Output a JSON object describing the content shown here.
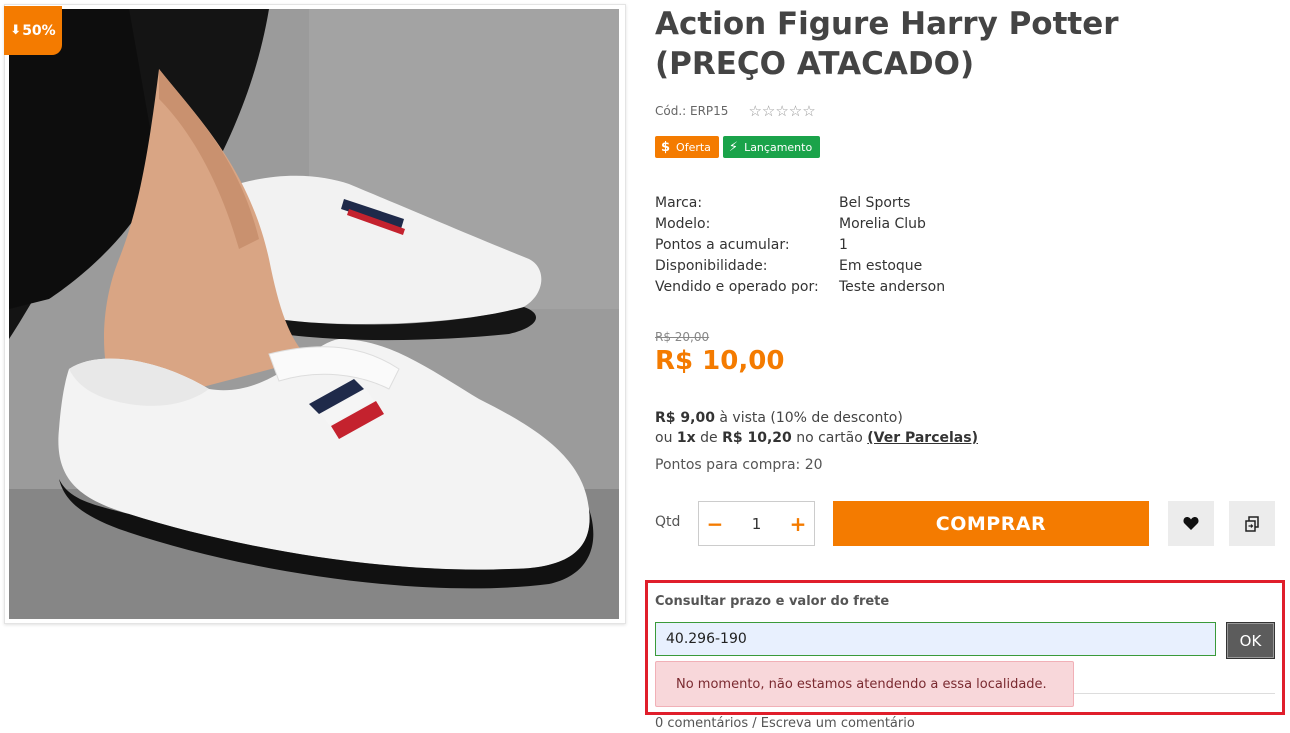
{
  "product": {
    "discount_badge": "50%",
    "title": "Action Figure Harry Potter (PREÇO ATACADO)",
    "sku": "Cód.: ERP15",
    "rating_stars": "☆☆☆☆☆",
    "tags": [
      {
        "icon": "$",
        "label": "Oferta"
      },
      {
        "icon": "⚡",
        "label": "Lançamento"
      }
    ],
    "specs": [
      {
        "label": "Marca:",
        "value": "Bel Sports"
      },
      {
        "label": "Modelo:",
        "value": "Morelia Club"
      },
      {
        "label": "Pontos a acumular:",
        "value": "1"
      },
      {
        "label": "Disponibilidade:",
        "value": "Em estoque"
      },
      {
        "label": "Vendido e operado por:",
        "value": "Teste anderson"
      }
    ],
    "old_price": "R$ 20,00",
    "price": "R$ 10,00",
    "cash_price": "R$ 9,00",
    "cash_text": " à vista (10% de desconto)",
    "installments_prefix": "ou ",
    "installments_count": "1x",
    "installments_de": " de ",
    "installments_value": "R$ 10,20",
    "installments_suffix": " no cartão ",
    "installments_link": "(Ver Parcelas)",
    "points_text": "Pontos para compra: 20"
  },
  "purchase": {
    "qty_label": "Qtd",
    "qty_value": "1",
    "minus": "−",
    "plus": "+",
    "buy_label": "COMPRAR"
  },
  "shipping": {
    "label": "Consultar prazo e valor do frete",
    "cep_value": "40.296-190",
    "ok_label": "OK",
    "error_message": "No momento, não estamos atendendo a essa localidade."
  },
  "comments_text": "0 comentários / Escreva um comentário",
  "colors": {
    "accent": "#f47b00",
    "launch_tag": "#1aa34a",
    "highlight": "#e01e2b"
  }
}
